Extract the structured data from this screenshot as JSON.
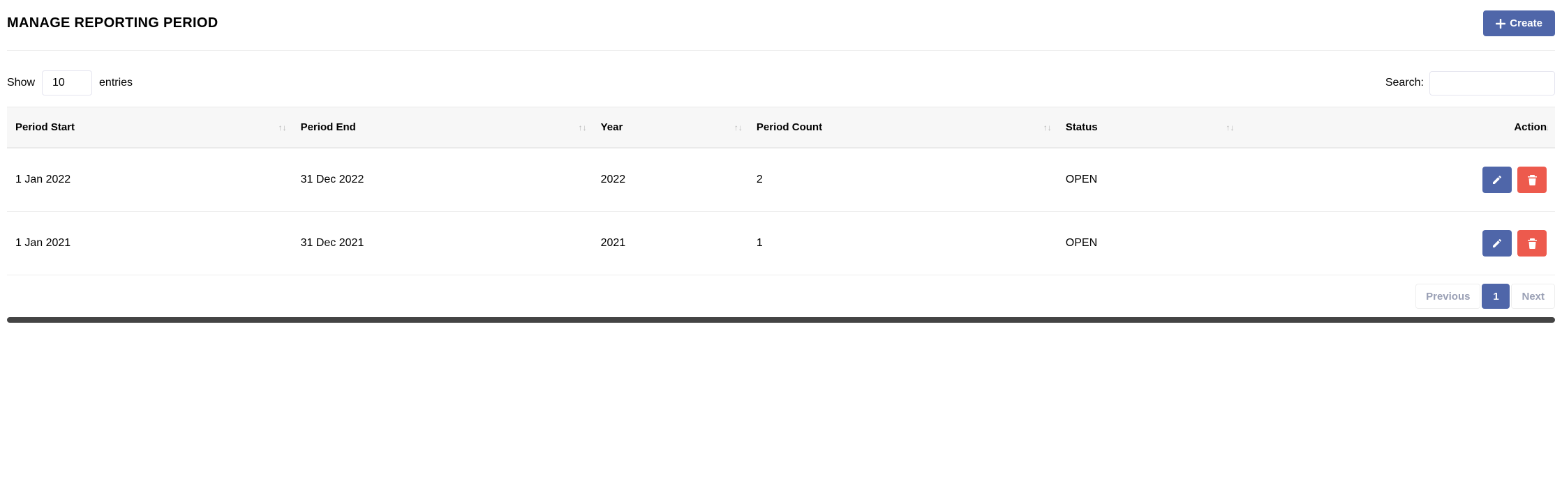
{
  "header": {
    "title": "MANAGE REPORTING PERIOD",
    "create_label": "Create"
  },
  "controls": {
    "show_label": "Show",
    "entries_label": "entries",
    "entries_value": "10",
    "search_label": "Search:"
  },
  "table": {
    "columns": {
      "period_start": "Period Start",
      "period_end": "Period End",
      "year": "Year",
      "period_count": "Period Count",
      "status": "Status",
      "action": "Action"
    },
    "rows": [
      {
        "period_start": "1 Jan 2022",
        "period_end": "31 Dec 2022",
        "year": "2022",
        "period_count": "2",
        "status": "OPEN"
      },
      {
        "period_start": "1 Jan 2021",
        "period_end": "31 Dec 2021",
        "year": "2021",
        "period_count": "1",
        "status": "OPEN"
      }
    ]
  },
  "pagination": {
    "previous": "Previous",
    "next": "Next",
    "current": "1"
  }
}
